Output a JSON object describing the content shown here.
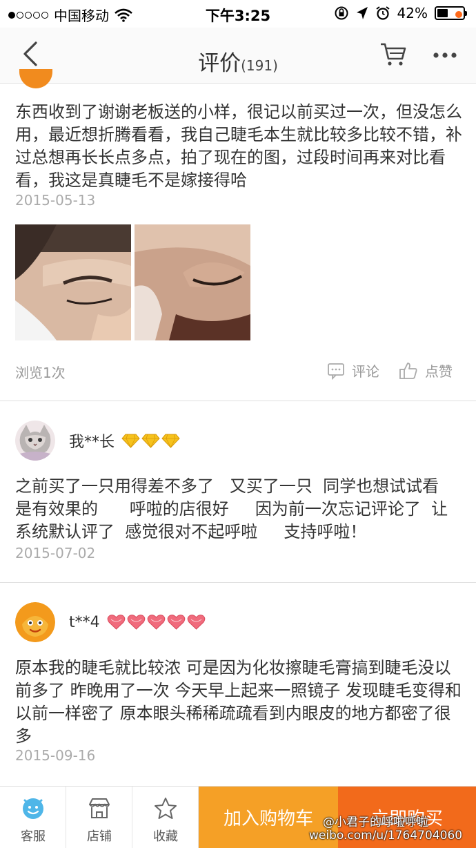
{
  "status_bar": {
    "carrier": "中国移动",
    "time": "下午3:25",
    "battery": "42%",
    "battery_level": 0.42
  },
  "nav": {
    "title": "评价",
    "count": "(191)",
    "has_notification_dot": true
  },
  "reviews": [
    {
      "text": "东西收到了谢谢老板送的小样，很记以前买过一次，但没怎么用，最近想折腾看看，我自己睫毛本生就比较多比较不错，补过总想再长长点多点，拍了现在的图，过段时间再来对比看看，我这是真睫毛不是嫁接得哈",
      "date": "2015-05-13",
      "photos": [
        "eyelash-photo-1",
        "eyelash-photo-2"
      ],
      "views": "浏览1次",
      "comment_label": "评论",
      "like_label": "点赞"
    },
    {
      "username": "我**长",
      "rank_icon": "diamond-icon",
      "rank_count": 3,
      "text": "之前买了一只用得差不多了   又买了一只  同学也想试试看   是有效果的      呼啦的店很好     因为前一次忘记评论了  让系统默认评了  感觉很对不起呼啦     支持呼啦！",
      "date": "2015-07-02"
    },
    {
      "username": "t**4",
      "rank_icon": "heart-icon",
      "rank_count": 5,
      "text": "原本我的睫毛就比较浓 可是因为化妆擦睫毛膏搞到睫毛没以前多了 昨晚用了一次 今天早上起来一照镜子 发现睫毛变得和以前一样密了 原本眼头稀稀疏疏看到内眼皮的地方都密了很多",
      "date": "2015-09-16"
    }
  ],
  "bottom_bar": {
    "service_label": "客服",
    "shop_label": "店铺",
    "favorite_label": "收藏",
    "add_cart_label": "加入购物车",
    "buy_now_label": "立即购买"
  },
  "watermark": {
    "line1": "@小君子的呼啦呼啦",
    "line2": "weibo.com/u/1764704060"
  },
  "colors": {
    "add_cart": "#f5a026",
    "buy_now": "#f26a1b",
    "diamond": "#f6c21c",
    "heart": "#f06b7c"
  }
}
